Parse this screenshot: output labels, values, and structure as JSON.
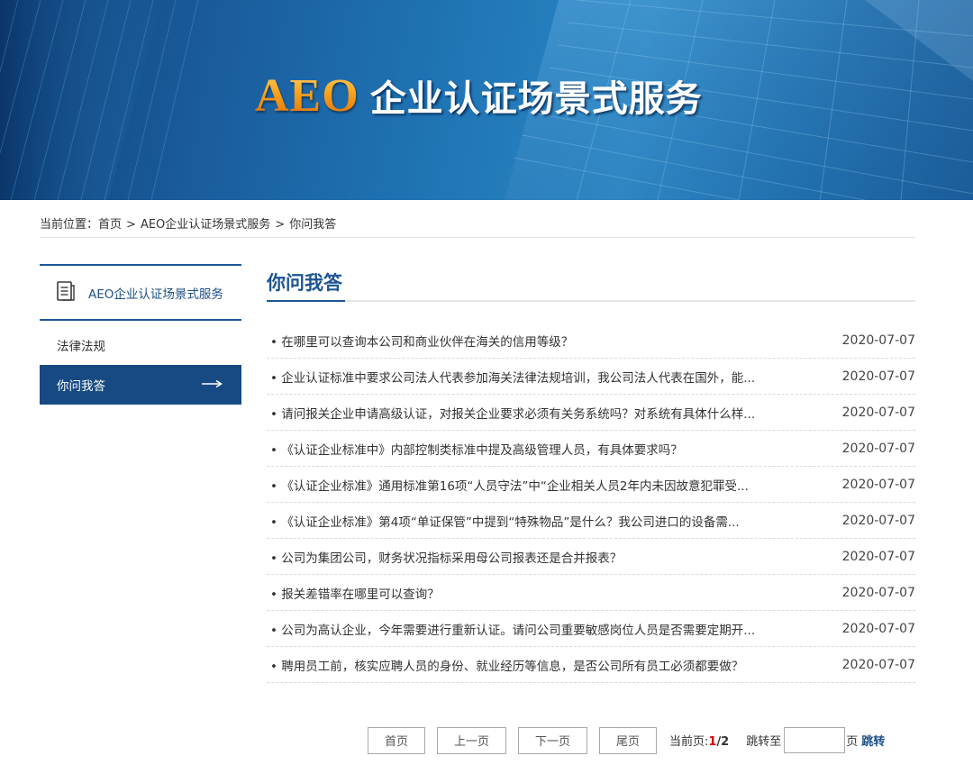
{
  "banner": {
    "title_brand": "AEO",
    "title_text": "企业认证场景式服务"
  },
  "breadcrumb": {
    "prefix": "当前位置：",
    "items": [
      "首页",
      "AEO企业认证场景式服务",
      "你问我答"
    ],
    "separator": ">"
  },
  "sidebar": {
    "header": "AEO企业认证场景式服务",
    "header_icon": "document-icon",
    "items": [
      {
        "label": "法律法规",
        "active": false
      },
      {
        "label": "你问我答",
        "active": true
      }
    ]
  },
  "main": {
    "title": "你问我答",
    "items": [
      {
        "title": "• 在哪里可以查询本公司和商业伙伴在海关的信用等级？",
        "date": "2020-07-07"
      },
      {
        "title": "• 企业认证标准中要求公司法人代表参加海关法律法规培训，我公司法人代表在国外，能...",
        "date": "2020-07-07"
      },
      {
        "title": "• 请问报关企业申请高级认证，对报关企业要求必须有关务系统吗？对系统有具体什么样...",
        "date": "2020-07-07"
      },
      {
        "title": "• 《认证企业标准中》内部控制类标准中提及高级管理人员，有具体要求吗？",
        "date": "2020-07-07"
      },
      {
        "title": "• 《认证企业标准》通用标准第16项“人员守法”中“企业相关人员2年内未因故意犯罪受...",
        "date": "2020-07-07"
      },
      {
        "title": "• 《认证企业标准》第4项“单证保管”中提到“特殊物品”是什么？我公司进口的设备需...",
        "date": "2020-07-07"
      },
      {
        "title": "• 公司为集团公司，财务状况指标采用母公司报表还是合并报表？",
        "date": "2020-07-07"
      },
      {
        "title": "• 报关差错率在哪里可以查询？",
        "date": "2020-07-07"
      },
      {
        "title": "• 公司为高认企业，今年需要进行重新认证。请问公司重要敏感岗位人员是否需要定期开...",
        "date": "2020-07-07"
      },
      {
        "title": "• 聘用员工前，核实应聘人员的身份、就业经历等信息，是否公司所有员工必须都要做？",
        "date": "2020-07-07"
      }
    ]
  },
  "pagination": {
    "first": "首页",
    "prev": "上一页",
    "next": "下一页",
    "last": "尾页",
    "current_label": "当前页:",
    "current": "1",
    "total": "/2",
    "jump_label": "跳转至",
    "jump_value": "",
    "unit": "页",
    "go": "跳转"
  },
  "colors": {
    "primary": "#1d5592",
    "active_bg": "#174a82",
    "brand_orange": "#f59a1a",
    "current_page": "#d40000"
  }
}
